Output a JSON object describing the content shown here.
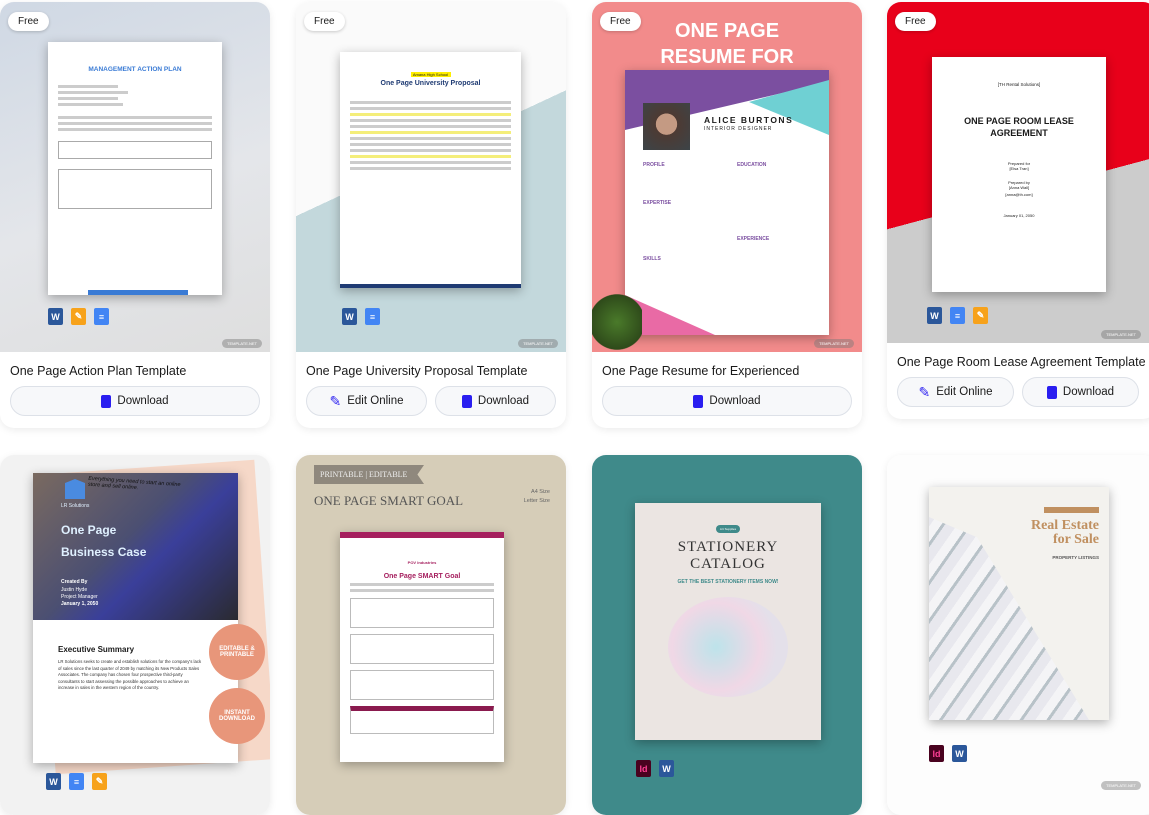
{
  "badge": "Free",
  "watermark": "TEMPLATE.NET",
  "colors": {
    "accent": "#2a1ef0",
    "button_bg": "#f7f8fa"
  },
  "cards": [
    {
      "title": "One Page Action Plan Template",
      "thumb_heading": "MANAGEMENT ACTION PLAN",
      "formats": [
        "word",
        "pages",
        "docs"
      ],
      "buttons": [
        {
          "label": "Download",
          "icon": "download-file-icon"
        }
      ]
    },
    {
      "title": "One Page University Proposal Template",
      "thumb_heading": "One Page University Proposal",
      "thumb_org": "Amana High School",
      "formats": [
        "word",
        "docs"
      ],
      "buttons": [
        {
          "label": "Edit Online",
          "icon": "pencil-icon"
        },
        {
          "label": "Download",
          "icon": "download-file-icon"
        }
      ]
    },
    {
      "title": "One Page Resume for Experienced",
      "thumb_heading": "ONE PAGE RESUME FOR EXPERIENCED",
      "thumb_name": "ALICE BURTONS",
      "thumb_role": "INTERIOR DESIGNER",
      "thumb_sections": [
        "PROFILE",
        "EDUCATION",
        "EXPERTISE",
        "EXPERIENCE",
        "SKILLS"
      ],
      "buttons": [
        {
          "label": "Download",
          "icon": "download-file-icon"
        }
      ]
    },
    {
      "title": "One Page Room Lease Agreement Template",
      "thumb_company": "[TH Rental Solutions]",
      "thumb_heading": "ONE PAGE ROOM LEASE AGREEMENT",
      "thumb_prepared_for": "Prepared for",
      "thumb_client": "[Elsa Tran]",
      "thumb_prepared_by": "Prepared by",
      "thumb_author": "[Anna Wall]",
      "thumb_email": "[anna@th.com]",
      "thumb_date": "January 01, 2050",
      "formats": [
        "word",
        "docs",
        "pages"
      ],
      "buttons": [
        {
          "label": "Edit Online",
          "icon": "pencil-icon"
        },
        {
          "label": "Download",
          "icon": "download-file-icon"
        }
      ]
    },
    {
      "thumb_tagline": "Everything you need to start an online store and sell online.",
      "thumb_company": "LR Solutions",
      "thumb_heading1": "One Page",
      "thumb_heading2": "Business Case",
      "thumb_created": "Created By",
      "thumb_author": "Justin Hyde",
      "thumb_author_role": "Project Manager",
      "thumb_date": "January 1, 2050",
      "thumb_section": "Executive Summary",
      "thumb_body": "LR Solutions seeks to create and establish solutions for the company's lack of sales since the last quarter of 2049 by matching its New Products Sales Associates. The company has chosen four prospective third-party consultants to start assessing the possible approaches to achieve an increase in sales in the western region of the country.",
      "badge1": "EDITABLE & PRINTABLE",
      "badge2": "INSTANT DOWNLOAD",
      "formats": [
        "word",
        "docs",
        "pages"
      ]
    },
    {
      "thumb_banner": "PRINTABLE | EDITABLE",
      "thumb_heading": "ONE PAGE SMART GOAL",
      "thumb_size1": "A4 Size",
      "thumb_size2": "Letter Size",
      "thumb_company": "POV Industries",
      "thumb_doc_title": "One Page SMART Goal"
    },
    {
      "thumb_pill": "Art Supplies",
      "thumb_heading1": "STATIONERY",
      "thumb_heading2": "CATALOG",
      "thumb_sub": "GET THE BEST STATIONERY ITEMS NOW!",
      "formats": [
        "indesign",
        "word"
      ]
    },
    {
      "thumb_heading1": "Real Estate",
      "thumb_heading2": "for Sale",
      "thumb_sub": "PROPERTY LISTINGS",
      "formats": [
        "indesign",
        "word"
      ]
    }
  ]
}
